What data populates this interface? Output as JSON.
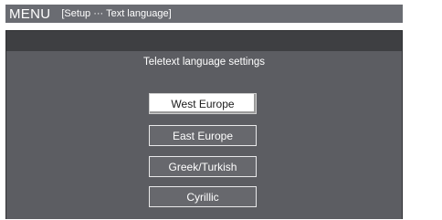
{
  "menu_bar": {
    "title": "MENU",
    "path": "[Setup ··· Text language]"
  },
  "dialog": {
    "title": "Teletext language settings",
    "options": [
      {
        "label": "West Europe",
        "selected": true
      },
      {
        "label": "East Europe",
        "selected": false
      },
      {
        "label": "Greek/Turkish",
        "selected": false
      },
      {
        "label": "Cyrillic",
        "selected": false
      }
    ]
  },
  "colors": {
    "menu_bar": "#6a6c72",
    "panel_background": "#5c5d62",
    "panel_header": "#3e3f42",
    "selected_option": "#ffffff"
  }
}
